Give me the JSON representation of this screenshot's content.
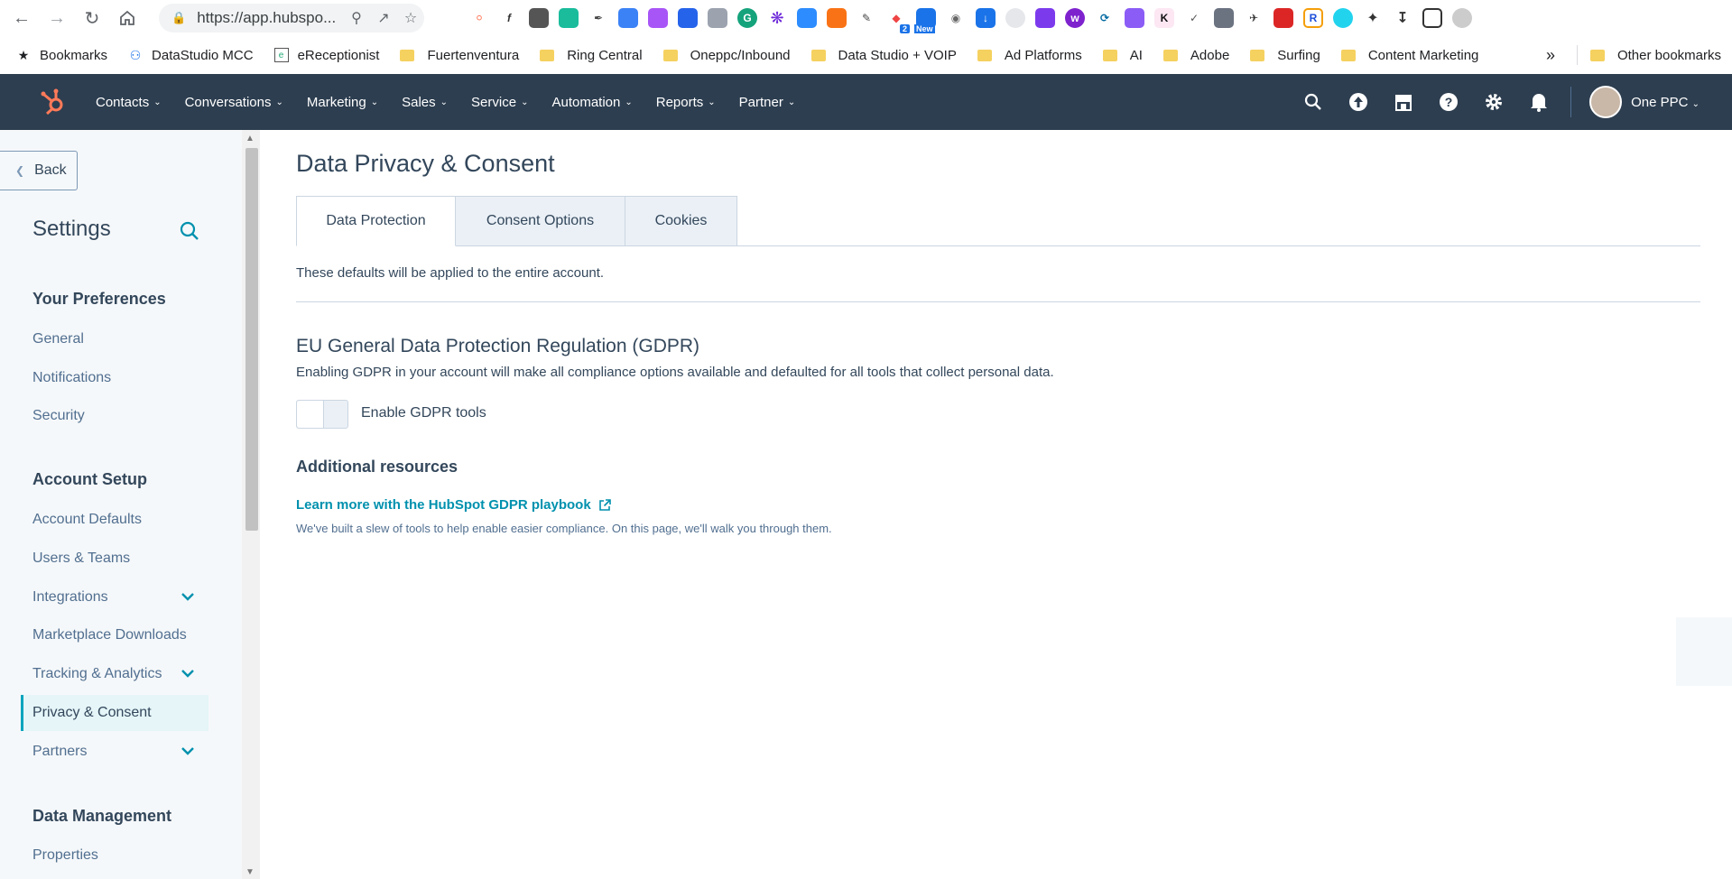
{
  "browser": {
    "url": "https://app.hubspo...",
    "bookmarks": [
      {
        "label": "Bookmarks",
        "type": "star"
      },
      {
        "label": "DataStudio MCC",
        "type": "fav"
      },
      {
        "label": "eReceptionist",
        "type": "fav"
      },
      {
        "label": "Fuertenventura",
        "type": "folder"
      },
      {
        "label": "Ring Central",
        "type": "folder"
      },
      {
        "label": "Oneppc/Inbound",
        "type": "folder"
      },
      {
        "label": "Data Studio + VOIP",
        "type": "folder"
      },
      {
        "label": "Ad Platforms",
        "type": "folder"
      },
      {
        "label": "AI",
        "type": "folder"
      },
      {
        "label": "Adobe",
        "type": "folder"
      },
      {
        "label": "Surfing",
        "type": "folder"
      },
      {
        "label": "Content Marketing",
        "type": "folder"
      }
    ],
    "overflow": "»",
    "other_bookmarks": "Other bookmarks",
    "ext_badge_2": "2",
    "ext_badge_new": "New"
  },
  "nav": {
    "items": [
      "Contacts",
      "Conversations",
      "Marketing",
      "Sales",
      "Service",
      "Automation",
      "Reports",
      "Partner"
    ],
    "account": "One PPC"
  },
  "sidebar": {
    "back": "Back",
    "title": "Settings",
    "sections": {
      "prefs": "Your Preferences",
      "setup": "Account Setup",
      "data": "Data Management"
    },
    "items": {
      "general": "General",
      "notifications": "Notifications",
      "security": "Security",
      "defaults": "Account Defaults",
      "users": "Users & Teams",
      "integrations": "Integrations",
      "marketplace": "Marketplace Downloads",
      "tracking": "Tracking & Analytics",
      "privacy": "Privacy & Consent",
      "partners": "Partners",
      "properties": "Properties"
    }
  },
  "main": {
    "title": "Data Privacy & Consent",
    "tabs": [
      "Data Protection",
      "Consent Options",
      "Cookies"
    ],
    "defaults_text": "These defaults will be applied to the entire account.",
    "gdpr_title": "EU General Data Protection Regulation (GDPR)",
    "gdpr_desc": "Enabling GDPR in your account will make all compliance options available and defaulted for all tools that collect personal data.",
    "toggle_label": "Enable GDPR tools",
    "resources_title": "Additional resources",
    "playbook_link": "Learn more with the HubSpot GDPR playbook",
    "playbook_desc": "We've built a slew of tools to help enable easier compliance. On this page, we'll walk you through them."
  }
}
